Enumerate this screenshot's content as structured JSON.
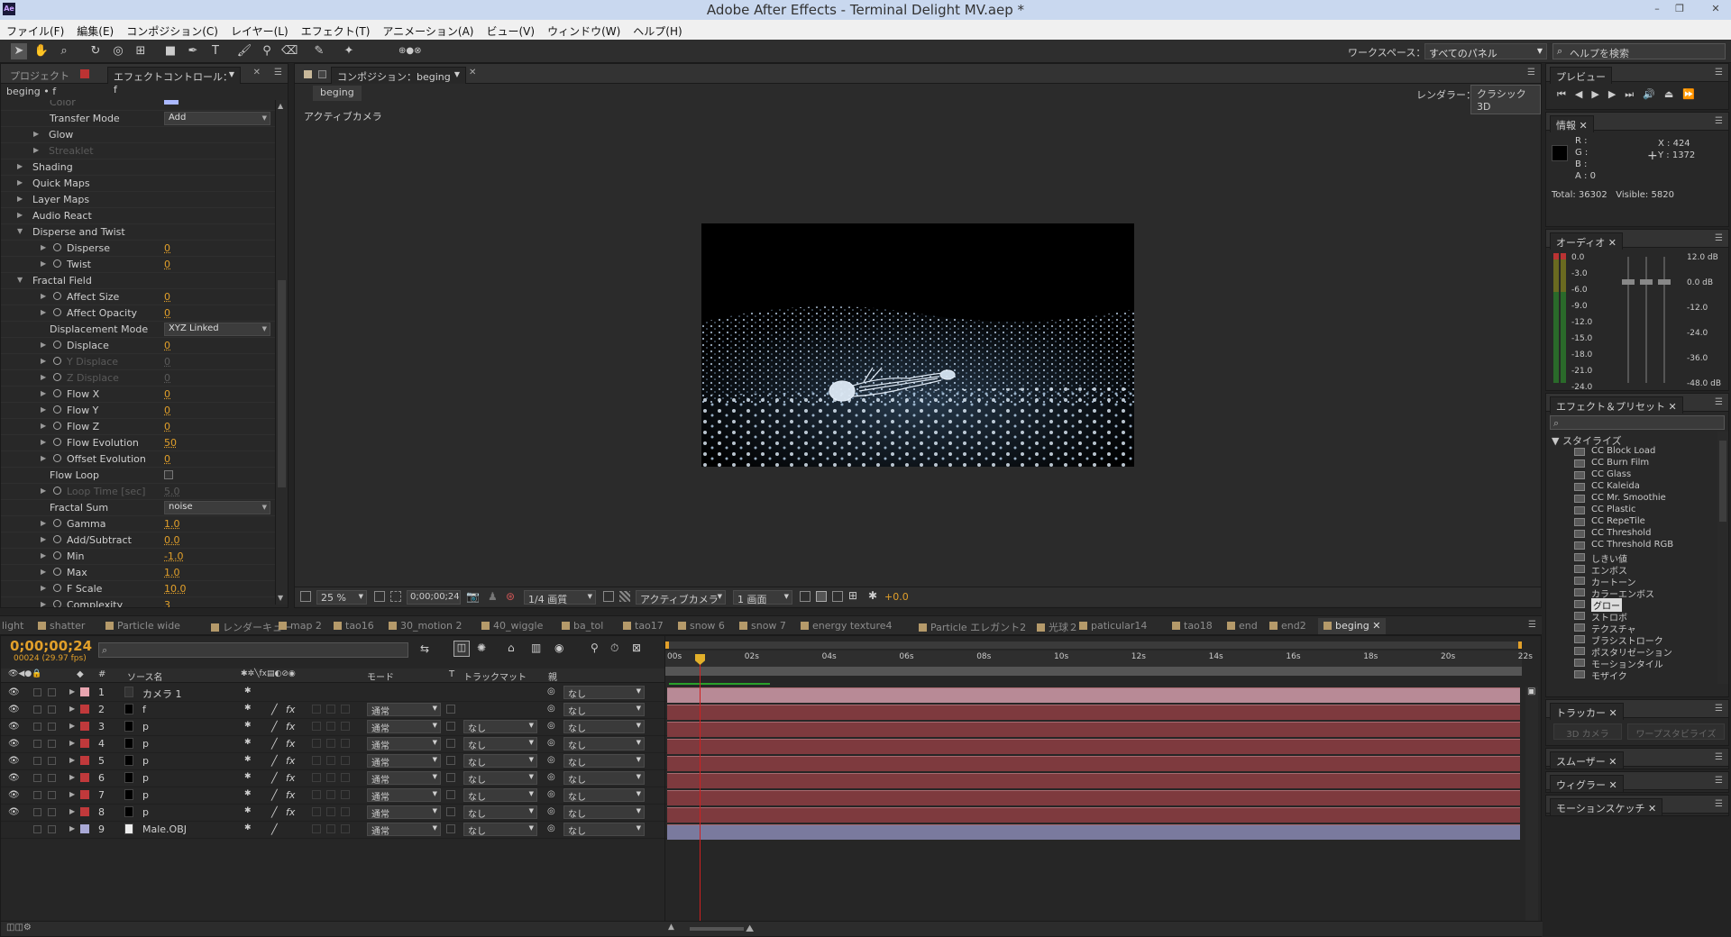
{
  "window": {
    "title": "Adobe After Effects - Terminal Delight MV.aep *",
    "logo": "Ae"
  },
  "menu": [
    "ファイル(F)",
    "編集(E)",
    "コンポジション(C)",
    "レイヤー(L)",
    "エフェクト(T)",
    "アニメーション(A)",
    "ビュー(V)",
    "ウィンドウ(W)",
    "ヘルプ(H)"
  ],
  "toolbar": {
    "workspace_label": "ワークスペース：",
    "workspace_value": "すべてのパネル",
    "help_placeholder": "ヘルプを検索"
  },
  "left_panel": {
    "tabs": [
      "プロジェクト",
      "エフェクトコントロール：f"
    ],
    "layer_path": "beging • f",
    "rows": [
      {
        "label": "Color",
        "indent": 2,
        "type": "color",
        "dim": true
      },
      {
        "label": "Transfer Mode",
        "indent": 2,
        "type": "dropdown",
        "value": "Add"
      },
      {
        "label": "Glow",
        "indent": 2,
        "type": "group"
      },
      {
        "label": "Streaklet",
        "indent": 2,
        "type": "group",
        "dim": true
      },
      {
        "label": "Shading",
        "indent": 1,
        "type": "group"
      },
      {
        "label": "Quick Maps",
        "indent": 1,
        "type": "group"
      },
      {
        "label": "Layer Maps",
        "indent": 1,
        "type": "group"
      },
      {
        "label": "Audio React",
        "indent": 1,
        "type": "group"
      },
      {
        "label": "Disperse and Twist",
        "indent": 1,
        "type": "group",
        "open": true
      },
      {
        "label": "Disperse",
        "indent": 2,
        "type": "value",
        "value": "0"
      },
      {
        "label": "Twist",
        "indent": 2,
        "type": "value",
        "value": "0"
      },
      {
        "label": "Fractal Field",
        "indent": 1,
        "type": "group",
        "open": true
      },
      {
        "label": "Affect Size",
        "indent": 2,
        "type": "value",
        "value": "0"
      },
      {
        "label": "Affect Opacity",
        "indent": 2,
        "type": "value",
        "value": "0"
      },
      {
        "label": "Displacement Mode",
        "indent": 2,
        "type": "dropdown",
        "value": "XYZ Linked"
      },
      {
        "label": "Displace",
        "indent": 2,
        "type": "value",
        "value": "0"
      },
      {
        "label": "Y Displace",
        "indent": 2,
        "type": "value",
        "value": "0",
        "dim": true
      },
      {
        "label": "Z Displace",
        "indent": 2,
        "type": "value",
        "value": "0",
        "dim": true
      },
      {
        "label": "Flow X",
        "indent": 2,
        "type": "value",
        "value": "0"
      },
      {
        "label": "Flow Y",
        "indent": 2,
        "type": "value",
        "value": "0"
      },
      {
        "label": "Flow Z",
        "indent": 2,
        "type": "value",
        "value": "0"
      },
      {
        "label": "Flow Evolution",
        "indent": 2,
        "type": "value",
        "value": "50"
      },
      {
        "label": "Offset Evolution",
        "indent": 2,
        "type": "value",
        "value": "0"
      },
      {
        "label": "Flow Loop",
        "indent": 2,
        "type": "checkbox"
      },
      {
        "label": "Loop Time [sec]",
        "indent": 2,
        "type": "value",
        "value": "5.0",
        "dim": true
      },
      {
        "label": "Fractal Sum",
        "indent": 2,
        "type": "dropdown",
        "value": "noise"
      },
      {
        "label": "Gamma",
        "indent": 2,
        "type": "value",
        "value": "1.0"
      },
      {
        "label": "Add/Subtract",
        "indent": 2,
        "type": "value",
        "value": "0.0"
      },
      {
        "label": "Min",
        "indent": 2,
        "type": "value",
        "value": "-1.0"
      },
      {
        "label": "Max",
        "indent": 2,
        "type": "value",
        "value": "1.0"
      },
      {
        "label": "F Scale",
        "indent": 2,
        "type": "value",
        "value": "10.0"
      },
      {
        "label": "Complexity",
        "indent": 2,
        "type": "value",
        "value": "3"
      }
    ]
  },
  "comp_panel": {
    "tab": "コンポジション：beging",
    "subtab": "beging",
    "renderer_label": "レンダラー：",
    "renderer_value": "クラシック3D",
    "view_label": "アクティブカメラ",
    "footer": {
      "zoom": "25 %",
      "timecode": "0;00;00;24",
      "resolution": "1/4 画質",
      "camera": "アクティブカメラ",
      "views": "1 画面",
      "exposure": "+0.0"
    }
  },
  "comp_tabs": [
    "light",
    "shatter",
    "Particle wide",
    "レンダーキュー",
    "map 2",
    "tao16",
    "30_motion 2",
    "40_wiggle",
    "ba_tol",
    "tao17",
    "snow 6",
    "snow 7",
    "energy texture4",
    "Particle エレガント2",
    "光球２",
    "paticular14",
    "tao18",
    "end",
    "end2",
    "beging"
  ],
  "timeline": {
    "timecode": "0;00;00;24",
    "fps": "00024 (29.97 fps)",
    "columns": {
      "num": "#",
      "source": "ソース名",
      "mode": "モード",
      "t": "T",
      "track": "トラックマット",
      "parent": "親"
    },
    "ruler": [
      "00s",
      "02s",
      "04s",
      "06s",
      "08s",
      "10s",
      "12s",
      "14s",
      "16s",
      "18s",
      "20s",
      "22s"
    ],
    "layers": [
      {
        "num": "1",
        "name": "カメラ 1",
        "color": "#e8a5b0",
        "mode": "",
        "track": "",
        "parent": "なし",
        "bar": "#b88a96"
      },
      {
        "num": "2",
        "name": "f",
        "color": "#c0393b",
        "mode": "通常",
        "track": "",
        "parent": "なし",
        "bar": "#7e3a3e"
      },
      {
        "num": "3",
        "name": "p",
        "color": "#c0393b",
        "mode": "通常",
        "track": "なし",
        "parent": "なし",
        "bar": "#7e3a3e"
      },
      {
        "num": "4",
        "name": "p",
        "color": "#c0393b",
        "mode": "通常",
        "track": "なし",
        "parent": "なし",
        "bar": "#7e3a3e"
      },
      {
        "num": "5",
        "name": "p",
        "color": "#c0393b",
        "mode": "通常",
        "track": "なし",
        "parent": "なし",
        "bar": "#7e3a3e"
      },
      {
        "num": "6",
        "name": "p",
        "color": "#c0393b",
        "mode": "通常",
        "track": "なし",
        "parent": "なし",
        "bar": "#7e3a3e"
      },
      {
        "num": "7",
        "name": "p",
        "color": "#c0393b",
        "mode": "通常",
        "track": "なし",
        "parent": "なし",
        "bar": "#7e3a3e"
      },
      {
        "num": "8",
        "name": "p",
        "color": "#c0393b",
        "mode": "通常",
        "track": "なし",
        "parent": "なし",
        "bar": "#7e3a3e"
      },
      {
        "num": "9",
        "name": "Male.OBJ",
        "color": "#a9a9d6",
        "mode": "通常",
        "track": "なし",
        "parent": "なし",
        "bar": "#7a7a9e"
      }
    ]
  },
  "right": {
    "preview_tab": "プレビュー",
    "info_tab": "情報",
    "info": {
      "r": "R :",
      "g": "G :",
      "b": "B :",
      "a": "A : 0",
      "x": "X : 424",
      "y": "Y : 1372",
      "total": "Total: 36302",
      "visible": "Visible: 5820"
    },
    "audio_tab": "オーディオ",
    "audio_left": [
      "0.0",
      "-3.0",
      "-6.0",
      "-9.0",
      "-12.0",
      "-15.0",
      "-18.0",
      "-21.0",
      "-24.0"
    ],
    "audio_right": [
      "12.0 dB",
      "0.0 dB",
      "-12.0",
      "-24.0",
      "-36.0",
      "-48.0 dB"
    ],
    "effects_tab": "エフェクト＆プリセット",
    "category": "スタイライズ",
    "effects": [
      "CC Block Load",
      "CC Burn Film",
      "CC Glass",
      "CC Kaleida",
      "CC Mr. Smoothie",
      "CC Plastic",
      "CC RepeTile",
      "CC Threshold",
      "CC Threshold RGB",
      "しきい値",
      "エンボス",
      "カートーン",
      "カラーエンボス",
      "グロー",
      "ストロボ",
      "テクスチャ",
      "ブラシストローク",
      "ポスタリゼーション",
      "モーションタイル",
      "モザイク"
    ],
    "selected_effect": "グロー",
    "tracker_tab": "トラッカー",
    "tracker_btns": [
      "3D カメラ",
      "ワープスタビライズ"
    ],
    "smoother_tab": "スムーザー",
    "wiggler_tab": "ウィグラー",
    "sketch_tab": "モーションスケッチ"
  }
}
